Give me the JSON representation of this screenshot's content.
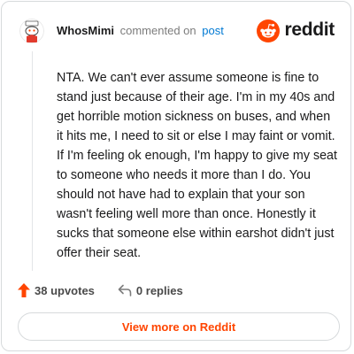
{
  "comment": {
    "username": "WhosMimi",
    "action_text": "commented on",
    "post_link_label": "post",
    "body": "NTA. We can't ever assume someone is fine to stand just because of their age. I'm in my 40s and get horrible motion sickness on buses, and when it hits me, I need to sit or else I may faint or vomit. If I'm feeling ok enough, I'm happy to give my seat to someone who needs it more than I do. You should not have had to explain that your son wasn't feeling well more than once. Honestly it sucks that someone else within earshot didn't just offer their seat.",
    "upvotes_label": "38 upvotes",
    "replies_label": "0 replies"
  },
  "brand": {
    "wordmark": "reddit",
    "icon": "reddit-snoo-icon",
    "color": "#ff4500"
  },
  "footer": {
    "view_more_label": "View more on Reddit"
  },
  "icons": {
    "avatar": "avatar-snoo-icon",
    "upvote": "upvote-arrow-icon",
    "reply": "reply-arrow-icon"
  },
  "colors": {
    "accent": "#ff4500",
    "link": "#0079d3",
    "muted": "#7c7c7c",
    "border": "#d7dadc"
  }
}
